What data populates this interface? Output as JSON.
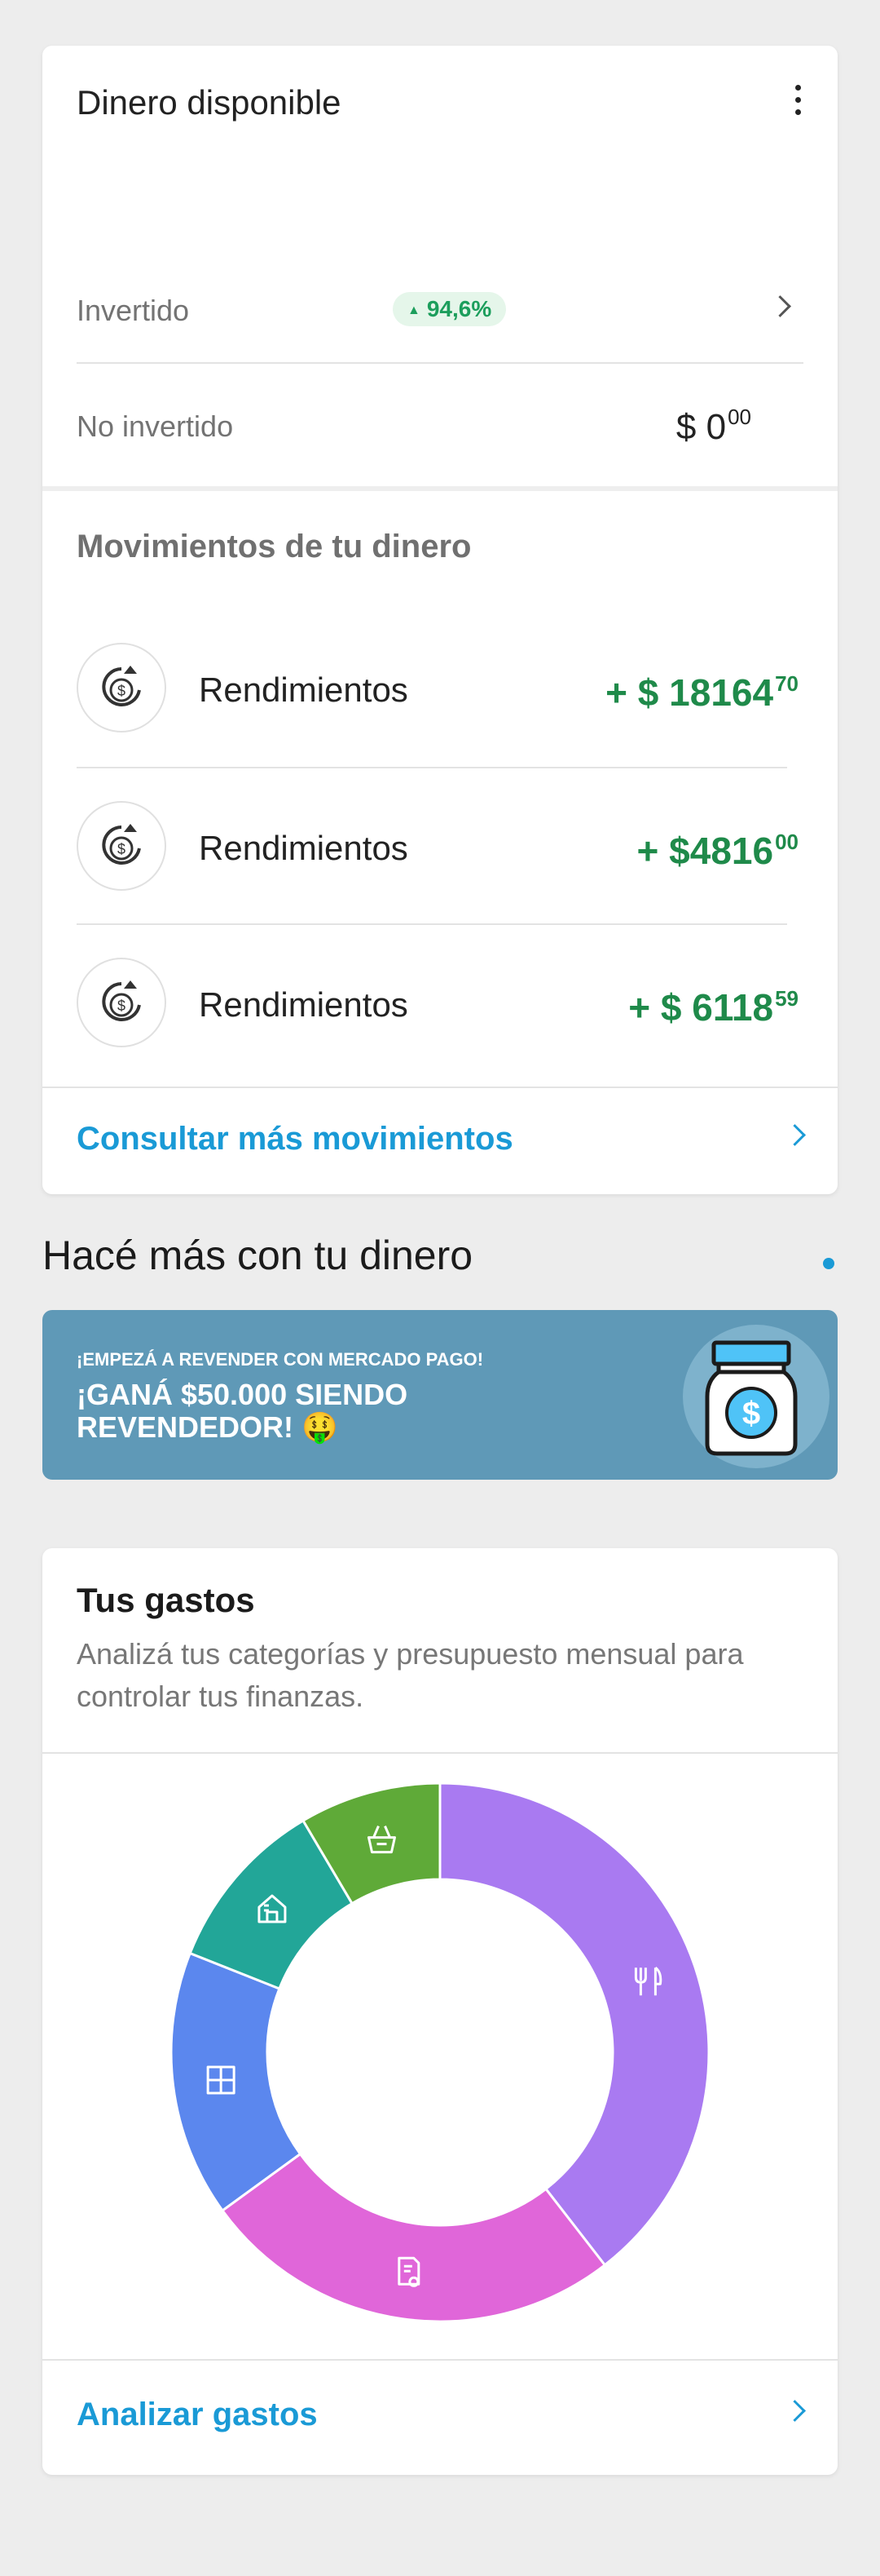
{
  "money_card": {
    "title": "Dinero disponible",
    "menu_icon": "kebab-icon",
    "invested": {
      "label": "Invertido",
      "badge": "94,6%",
      "badge_color": "#1c9e5c"
    },
    "not_invested": {
      "label": "No invertido",
      "currency": "$",
      "whole": "0",
      "cents": "00"
    }
  },
  "movements": {
    "title": "Movimientos de tu dinero",
    "items": [
      {
        "icon": "yield-coin-icon",
        "label": "Rendimientos",
        "sign": "+",
        "currency": "$",
        "whole": "18164",
        "cents": "70"
      },
      {
        "icon": "yield-coin-icon",
        "label": "Rendimientos",
        "sign": "+",
        "currency": "$",
        "whole": "4816",
        "cents": "00"
      },
      {
        "icon": "yield-coin-icon",
        "label": "Rendimientos",
        "sign": "+",
        "currency": "$",
        "whole": "6118",
        "cents": "59"
      }
    ],
    "more_link": "Consultar más movimientos",
    "amount_color": "#1f8a4a"
  },
  "section": {
    "title": "Hacé más con tu dinero"
  },
  "banner": {
    "small": "¡EMPEZÁ A REVENDER CON MERCADO PAGO!",
    "big": "¡GANÁ $50.000 SIENDO REVENDEDOR! 🤑",
    "icon": "money-jar-icon",
    "background": "#5f99b7"
  },
  "expenses": {
    "title": "Tus gastos",
    "description": "Analizá tus categorías y presupuesto mensual para controlar tus finanzas.",
    "link": "Analizar gastos",
    "accent": "#1a9ad6"
  },
  "chart_data": {
    "type": "pie",
    "donut": true,
    "segments": [
      {
        "icon": "restaurant-icon",
        "value": 39.5,
        "color": "#a97af1"
      },
      {
        "icon": "bill-icon",
        "value": 25.5,
        "color": "#e066d9"
      },
      {
        "icon": "grid-icon",
        "value": 16.0,
        "color": "#5b87ee"
      },
      {
        "icon": "home-icon",
        "value": 10.5,
        "color": "#22a698"
      },
      {
        "icon": "basket-icon",
        "value": 8.5,
        "color": "#5faa38"
      }
    ]
  }
}
